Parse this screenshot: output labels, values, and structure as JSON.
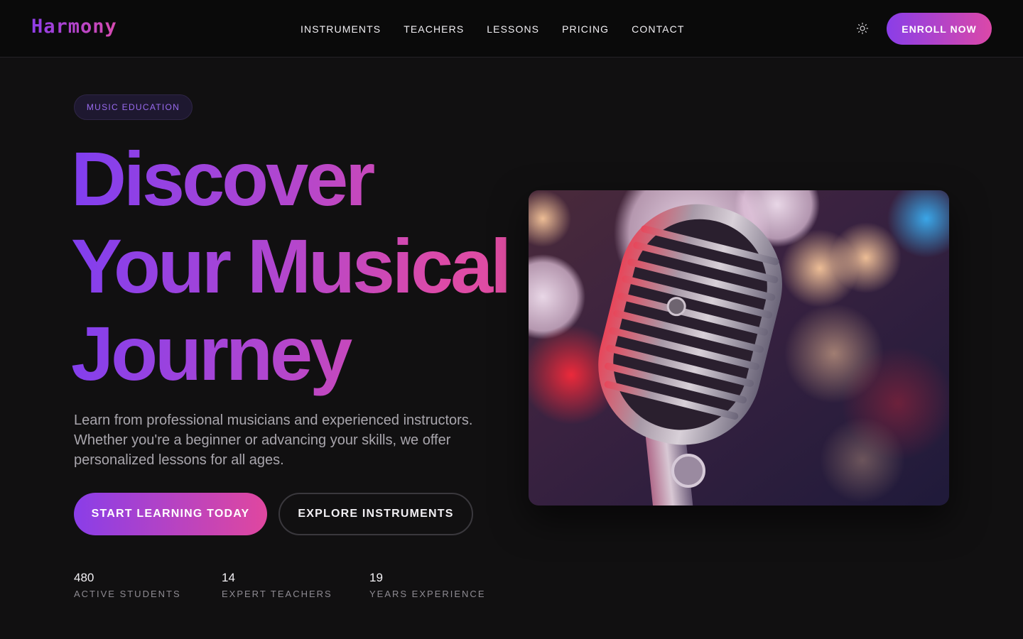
{
  "header": {
    "logo": "Harmony",
    "nav": [
      "INSTRUMENTS",
      "TEACHERS",
      "LESSONS",
      "PRICING",
      "CONTACT"
    ],
    "theme_icon": "sun-icon",
    "enroll_label": "ENROLL NOW"
  },
  "hero": {
    "badge": "MUSIC EDUCATION",
    "headline": [
      "Discover",
      "Your Musical",
      "Journey"
    ],
    "description": "Learn from professional musicians and experienced instructors. Whether you're a beginner or advancing your skills, we offer personalized lessons for all ages.",
    "primary_cta": "START LEARNING TODAY",
    "secondary_cta": "EXPLORE INSTRUMENTS",
    "image_subject": "vintage-microphone-photo"
  },
  "stats": [
    {
      "value": "480",
      "label": "ACTIVE STUDENTS"
    },
    {
      "value": "14",
      "label": "EXPERT TEACHERS"
    },
    {
      "value": "19",
      "label": "YEARS EXPERIENCE"
    }
  ],
  "colors": {
    "background": "#111011",
    "gradient_start": "#8a3ee8",
    "gradient_end": "#e0479f",
    "muted_text": "#a9a6ad"
  }
}
